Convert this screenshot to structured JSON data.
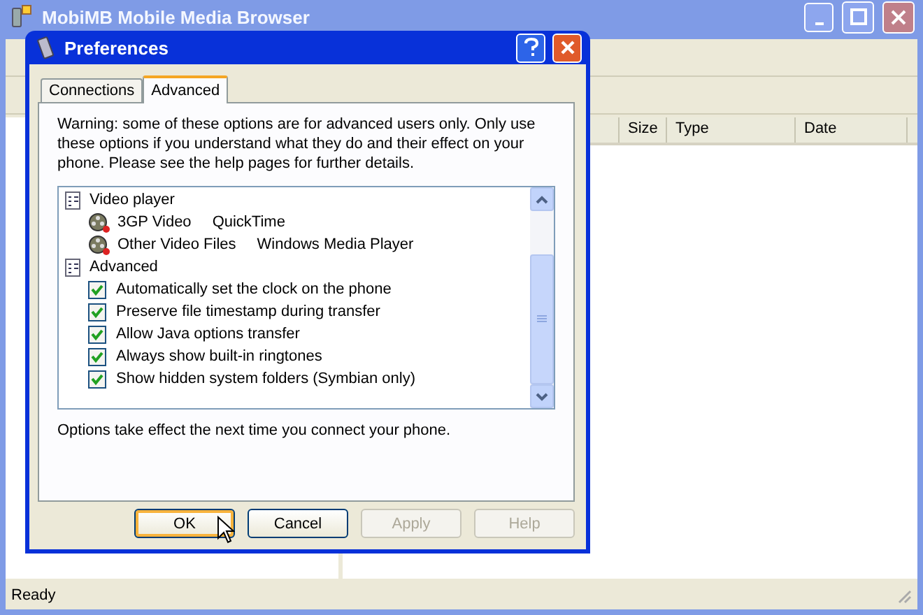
{
  "main_window": {
    "title": "MobiMB Mobile Media Browser",
    "columns": [
      "Size",
      "Type",
      "Date"
    ],
    "status": "Ready"
  },
  "dialog": {
    "title": "Preferences",
    "tabs": [
      {
        "label": "Connections",
        "selected": false
      },
      {
        "label": "Advanced",
        "selected": true
      }
    ],
    "warning": "Warning: some of these options are for advanced users only.  Only use these options if you understand what they do and their effect on your phone.  Please see the help pages for further details.",
    "groups": [
      {
        "label": "Video player",
        "children": [
          {
            "kind": "association",
            "label": "3GP Video",
            "value": "QuickTime"
          },
          {
            "kind": "association",
            "label": "Other Video Files",
            "value": "Windows Media Player"
          }
        ]
      },
      {
        "label": "Advanced",
        "children": [
          {
            "kind": "checkbox",
            "label": "Automatically set the clock on the phone",
            "checked": true
          },
          {
            "kind": "checkbox",
            "label": "Preserve file timestamp during transfer",
            "checked": true
          },
          {
            "kind": "checkbox",
            "label": "Allow Java options transfer",
            "checked": true
          },
          {
            "kind": "checkbox",
            "label": "Always show built-in ringtones",
            "checked": true
          },
          {
            "kind": "checkbox",
            "label": "Show hidden system folders (Symbian only)",
            "checked": true
          }
        ]
      }
    ],
    "note": "Options take effect the next time you connect your phone.",
    "buttons": [
      {
        "label": "OK",
        "disabled": false,
        "default": true
      },
      {
        "label": "Cancel",
        "disabled": false,
        "default": false
      },
      {
        "label": "Apply",
        "disabled": true,
        "default": false
      },
      {
        "label": "Help",
        "disabled": true,
        "default": false
      }
    ]
  }
}
